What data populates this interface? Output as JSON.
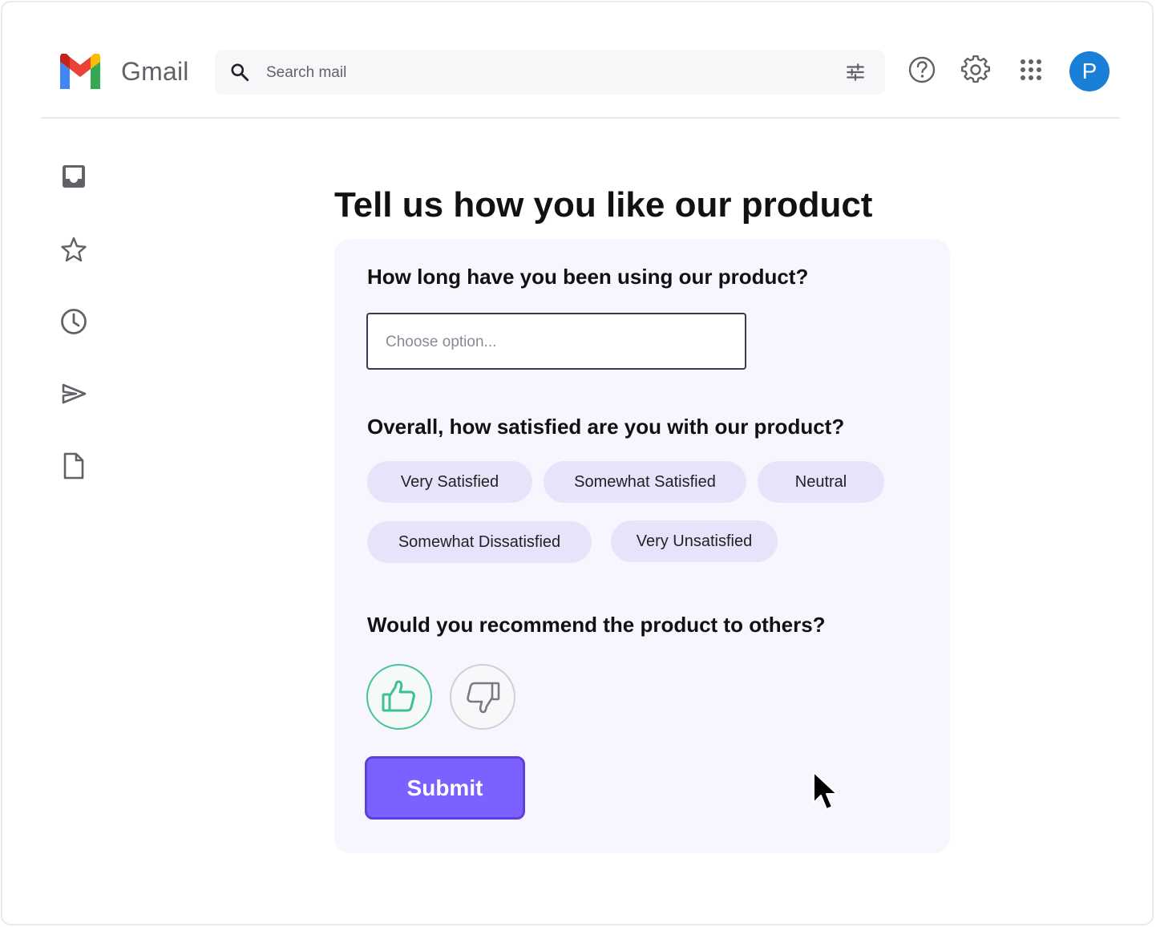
{
  "header": {
    "app_name": "Gmail",
    "search_placeholder": "Search mail",
    "avatar_initial": "P"
  },
  "sidebar": {
    "items": [
      {
        "name": "inbox-icon"
      },
      {
        "name": "star-icon"
      },
      {
        "name": "clock-icon"
      },
      {
        "name": "send-icon"
      },
      {
        "name": "document-icon"
      }
    ]
  },
  "survey": {
    "title": "Tell us how you like our product",
    "q1": {
      "label": "How long have you been using our product?",
      "placeholder": "Choose option..."
    },
    "q2": {
      "label": "Overall, how satisfied are you with our product?",
      "options": [
        "Very Satisfied",
        "Somewhat Satisfied",
        "Neutral",
        "Somewhat Dissatisfied",
        "Very Unsatisfied"
      ]
    },
    "q3": {
      "label": "Would you recommend the product to others?",
      "up_icon": "thumbs-up-icon",
      "down_icon": "thumbs-down-icon"
    },
    "submit_label": "Submit"
  },
  "colors": {
    "card_bg": "#f7f5fe",
    "chip_bg": "#e8e3fb",
    "submit_bg": "#7b61ff",
    "thumb_up_accent": "#45c49b",
    "avatar_bg": "#1a7fd6"
  }
}
